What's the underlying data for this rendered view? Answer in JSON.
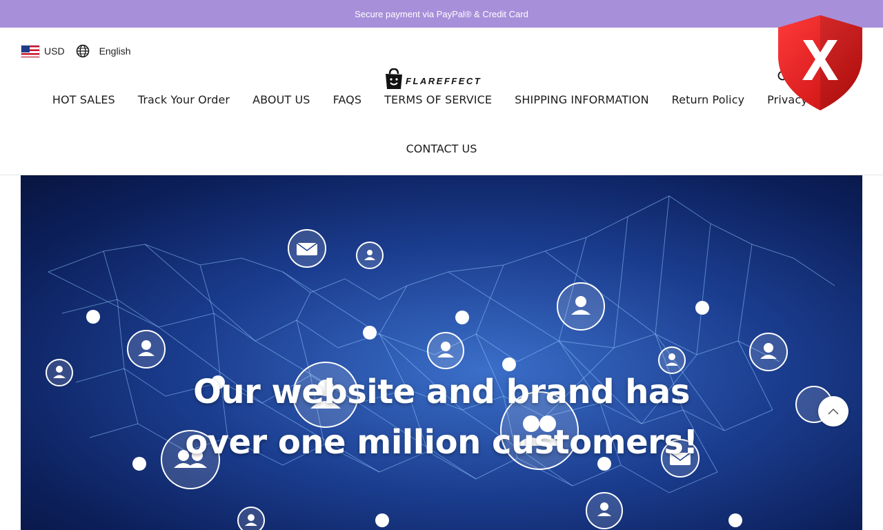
{
  "announcement": "Secure payment via PayPal® & Credit Card",
  "currency": "USD",
  "language": "English",
  "brand": "FLAREFFECT",
  "nav": {
    "row1": [
      "HOT SALES",
      "Track Your Order",
      "ABOUT US",
      "FAQS",
      "TERMS OF SERVICE",
      "SHIPPING INFORMATION",
      "Return Policy",
      "Privacy Poli"
    ],
    "row2": [
      "CONTACT US"
    ]
  },
  "hero": {
    "line1": "Our website and brand has",
    "line2": "over one million customers!"
  },
  "icons": [
    "us-flag-icon",
    "globe-icon",
    "logo-bag-icon",
    "search-icon",
    "red-shield-x-icon",
    "chevron-up-icon"
  ],
  "colors": {
    "announcement_bg": "#a78fd9",
    "shield": "#e01818",
    "hero_bg": "#1b3d8f"
  }
}
